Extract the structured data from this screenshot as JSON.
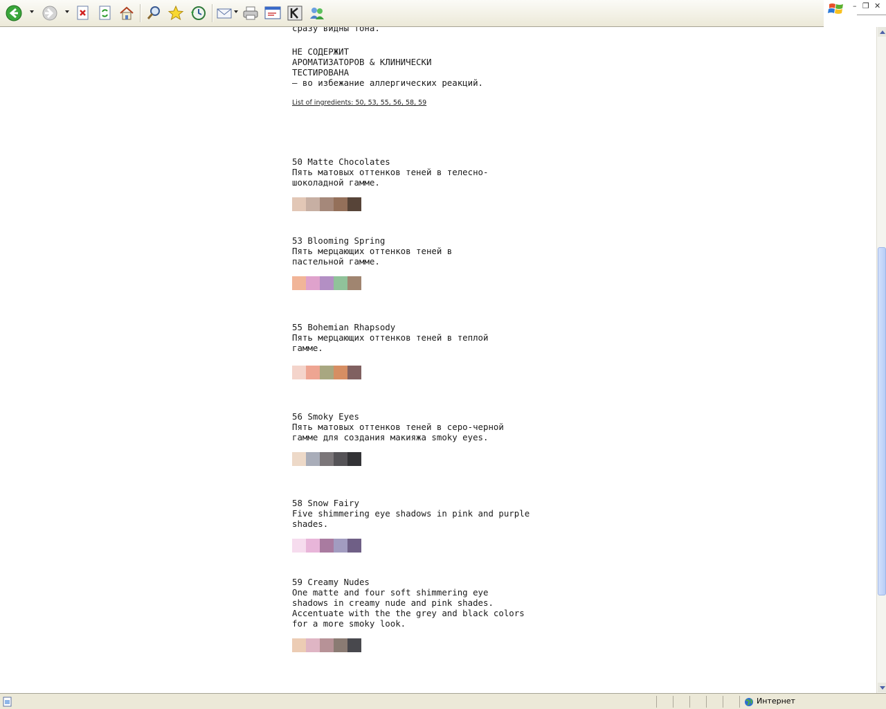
{
  "status": {
    "zone": "Интернет"
  },
  "content": {
    "partial_line": "сразу видны тона.",
    "warning": "НЕ СОДЕРЖИТ\nАРОМАТИЗАТОРОВ & КЛИНИЧЕСКИ\nТЕСТИРОВАНА\n– во избежание аллергических реакций.",
    "ingredients_link": "List of ingredients: 50, 53, 55, 56, 58, 59",
    "products": [
      {
        "title": "50 Matte Chocolates",
        "desc": "Пять матовых оттенков теней в телесно-\nшоколадной гамме.",
        "colors": [
          "#e2c7b6",
          "#c7afa3",
          "#a5887a",
          "#94705a",
          "#574438"
        ]
      },
      {
        "title": "53 Blooming Spring",
        "desc": "Пять мерцающих оттенков теней в\nпастельной гамме.",
        "colors": [
          "#f1b598",
          "#dfa2cc",
          "#b38fc4",
          "#90c29a",
          "#a08570"
        ]
      },
      {
        "title": "55 Bohemian Rhapsody",
        "desc": "Пять мерцающих оттенков теней в теплой\nгамме.",
        "colors": [
          "#f4d4cb",
          "#eea592",
          "#a8a781",
          "#d68e63",
          "#806060"
        ]
      },
      {
        "title": "56 Smoky Eyes",
        "desc": "Пять матовых оттенков теней в серо-черной\nгамме для создания макияжа smoky eyes.",
        "colors": [
          "#edd9c8",
          "#a9adb9",
          "#7b7679",
          "#555357",
          "#333336"
        ]
      },
      {
        "title": "58 Snow Fairy",
        "desc": "Five shimmering eye shadows in pink and purple\nshades.",
        "colors": [
          "#f6dcee",
          "#e8b5d9",
          "#a97ba0",
          "#a29cc0",
          "#6f5f86"
        ]
      },
      {
        "title": "59 Creamy Nudes",
        "desc": "One matte and four soft shimmering eye\nshadows in creamy nude and pink shades.\nAccentuate with the the grey and black colors\nfor a more smoky look.",
        "colors": [
          "#ecccb4",
          "#dfb5c4",
          "#b79297",
          "#8a7b73",
          "#48484d"
        ]
      }
    ]
  }
}
